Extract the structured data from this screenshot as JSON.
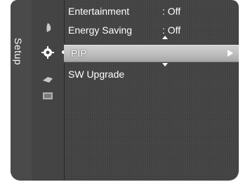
{
  "tab": {
    "label": "Setup"
  },
  "sidebar_icons": [
    {
      "icon": "picture-icon"
    },
    {
      "icon": "setup-gear-icon",
      "active": true
    },
    {
      "icon": "input-icon"
    },
    {
      "icon": "support-icon"
    }
  ],
  "menu": {
    "items": [
      {
        "label": "Entertainment",
        "value": ": Off"
      },
      {
        "label": "Energy Saving",
        "value": ": Off"
      },
      {
        "label": "PIP",
        "selected": true
      },
      {
        "label": "SW Upgrade"
      }
    ]
  }
}
